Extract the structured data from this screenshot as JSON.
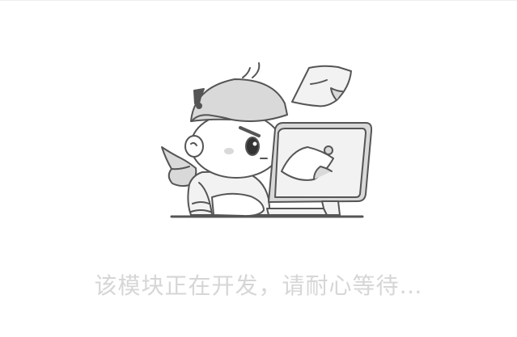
{
  "status": {
    "message": "该模块正在开发，请耐心等待…"
  },
  "illustration": {
    "icon": "developer-at-computer-illustration",
    "outline_color": "#555555",
    "fill_gray": "#d9d9d9",
    "fill_light": "#f2f2f2"
  }
}
